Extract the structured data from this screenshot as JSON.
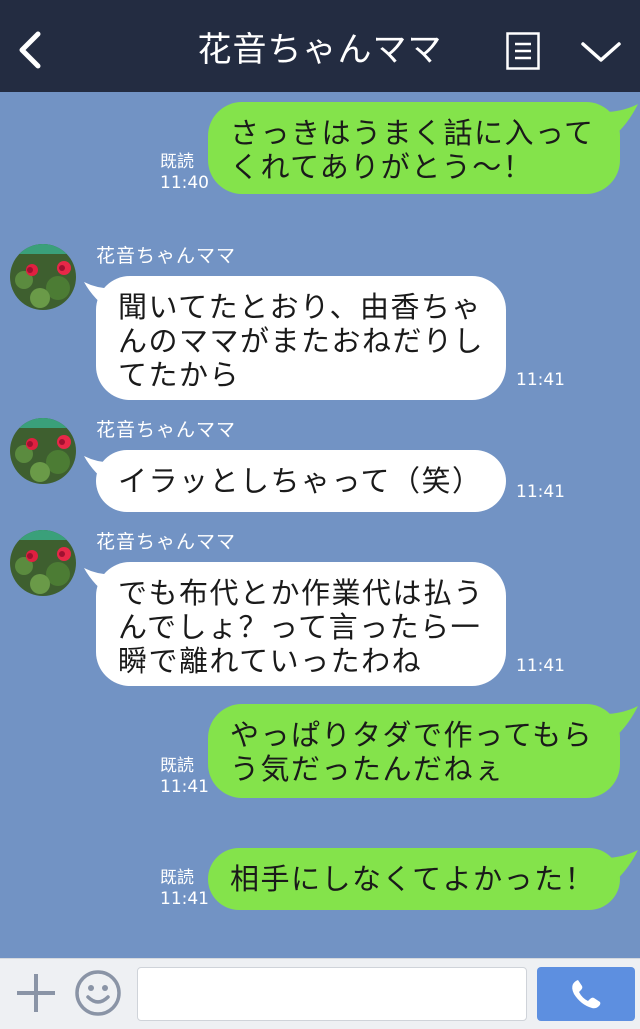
{
  "header": {
    "title": "花音ちゃんママ"
  },
  "contact": {
    "name": "花音ちゃんママ"
  },
  "messages": [
    {
      "from": "me",
      "lines": [
        "さっきはうまく話に入って",
        "くれてありがとう〜！"
      ],
      "read": "既読",
      "time": "11:40"
    },
    {
      "from": "them",
      "lines": [
        "聞いてたとおり、由香ちゃ",
        "んのママがまたおねだりし",
        "てたから"
      ],
      "time": "11:41"
    },
    {
      "from": "them",
      "lines": [
        "イラッとしちゃって（笑）"
      ],
      "time": "11:41"
    },
    {
      "from": "them",
      "lines": [
        "でも布代とか作業代は払う",
        "んでしょ？って言ったら一",
        "瞬で離れていったわね"
      ],
      "time": "11:41"
    },
    {
      "from": "me",
      "lines": [
        "やっぱりタダで作ってもら",
        "う気だったんだねぇ"
      ],
      "read": "既読",
      "time": "11:41"
    },
    {
      "from": "me",
      "lines": [
        "相手にしなくてよかった！"
      ],
      "read": "既読",
      "time": "11:41"
    }
  ],
  "footer": {
    "input_placeholder": ""
  },
  "colors": {
    "header_bg": "#232c41",
    "chat_bg": "#7293c4",
    "my_bubble": "#84e34b",
    "their_bubble": "#ffffff",
    "send_button": "#5d8fe0"
  },
  "icons": [
    "back-icon",
    "menu-icon",
    "chevron-down-icon",
    "plus-icon",
    "emoji-icon",
    "phone-icon"
  ]
}
